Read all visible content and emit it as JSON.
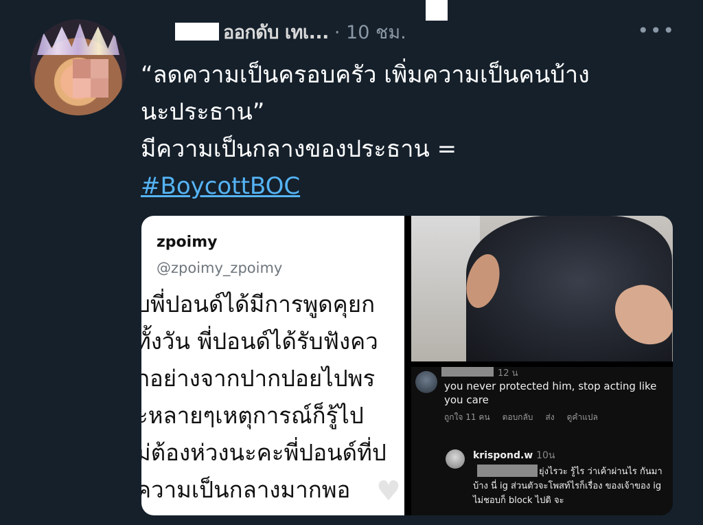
{
  "tweet": {
    "author_visible": "ออกดับ เทเ...",
    "time": "· 10 ชม.",
    "more_icon": "more-horizontal-icon",
    "text_lines": [
      "“ลดความเป็นครอบครัว เพิ่มความเป็นคนบ้าง",
      "นะประธาน”",
      "มีความเป็นกลางของประธาน ="
    ],
    "hashtag": "#BoycottBOC"
  },
  "media": {
    "left": {
      "name": "zpoimy",
      "handle": "@zpoimy_zpoimy",
      "lines": [
        "ับพี่ปอนด์ได้มีการพูดคุยก",
        "ทั้งวัน พี่ปอนด์ได้รับฟังคว",
        "กอย่างจากปากปอยไปพร",
        "ะหลายๆเหตุการณ์ก็รู้ไป",
        "ม่ต้องห่วงนะคะพี่ปอนด์ที่ป",
        "ความเป็นกลางมากพอ"
      ]
    },
    "comments": {
      "c1_time": "12 น",
      "c1_text": "you never protected him, stop acting like you care",
      "c1_actions": [
        "ถูกใจ 11 คน",
        "ตอบกลับ",
        "ส่ง",
        "ดูคำแปล"
      ],
      "c2_user": "krispond.w",
      "c2_time": "10น",
      "c2_text": "ยุ่งไรวะ รู้ไร ว่าเค้าผ่านไร กันมาบ้าง นี่ ig ส่วนตัวจะโพสท์ไรก็เรื่อง ของเจ้าของ ig ไม่ชอบก็ block ไปดิ จะ"
    }
  }
}
